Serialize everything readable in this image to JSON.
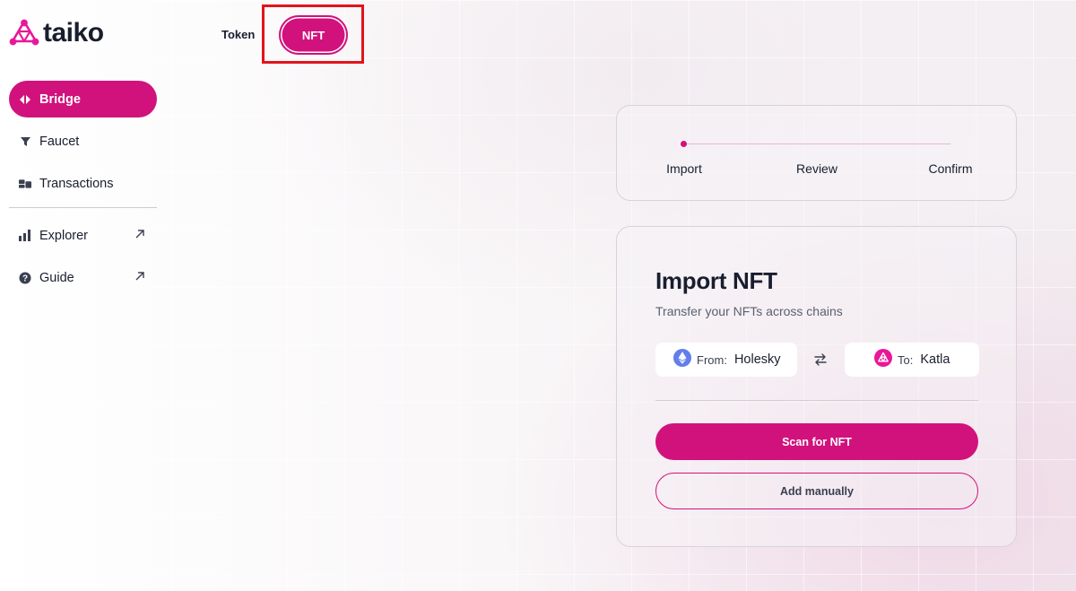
{
  "brand": {
    "name": "taiko",
    "accent": "#d1127c"
  },
  "sidebar": {
    "items": [
      {
        "label": "Bridge",
        "icon": "bridge-icon",
        "active": true
      },
      {
        "label": "Faucet",
        "icon": "faucet-icon"
      },
      {
        "label": "Transactions",
        "icon": "transactions-icon"
      },
      {
        "label": "Explorer",
        "icon": "explorer-icon",
        "external": true
      },
      {
        "label": "Guide",
        "icon": "guide-icon",
        "external": true
      }
    ]
  },
  "tabs": {
    "token": "Token",
    "nft": "NFT",
    "selected": "NFT"
  },
  "stepper": {
    "steps": [
      "Import",
      "Review",
      "Confirm"
    ],
    "current": "Import"
  },
  "import": {
    "title": "Import NFT",
    "subtitle": "Transfer your NFTs across chains",
    "from_prefix": "From:",
    "from_chain": "Holesky",
    "to_prefix": "To:",
    "to_chain": "Katla",
    "scan_label": "Scan for NFT",
    "manual_label": "Add manually"
  }
}
